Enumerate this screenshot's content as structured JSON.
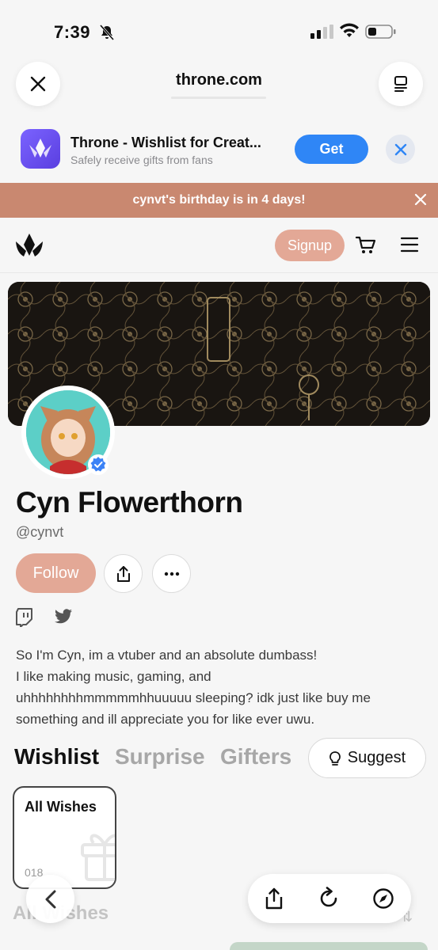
{
  "status_bar": {
    "time": "7:39"
  },
  "browser": {
    "domain": "throne.com"
  },
  "app_banner": {
    "title": "Throne - Wishlist for Creat...",
    "subtitle": "Safely receive gifts from fans",
    "get_label": "Get"
  },
  "notice": {
    "text": "cynvt's birthday is in 4 days!"
  },
  "site_nav": {
    "signup_label": "Signup"
  },
  "profile": {
    "name": "Cyn Flowerthorn",
    "handle": "@cynvt",
    "follow_label": "Follow",
    "bio_lines": [
      "So I'm Cyn, im a vtuber and an absolute dumbass!",
      "I like making music, gaming, and",
      "uhhhhhhhhmmmmmhhuuuuu sleeping? idk just like buy me",
      "something and ill appreciate you for like ever uwu."
    ]
  },
  "tabs": [
    {
      "label": "Wishlist",
      "active": true
    },
    {
      "label": "Surprise",
      "active": false
    },
    {
      "label": "Gifters",
      "active": false
    }
  ],
  "suggest_label": "Suggest",
  "wish_card": {
    "title": "All Wishes",
    "count": "018"
  },
  "section_heading": "All Wishes",
  "colors": {
    "accent": "#e3a896",
    "notice": "#c98870",
    "get_button": "#2f86f6"
  }
}
